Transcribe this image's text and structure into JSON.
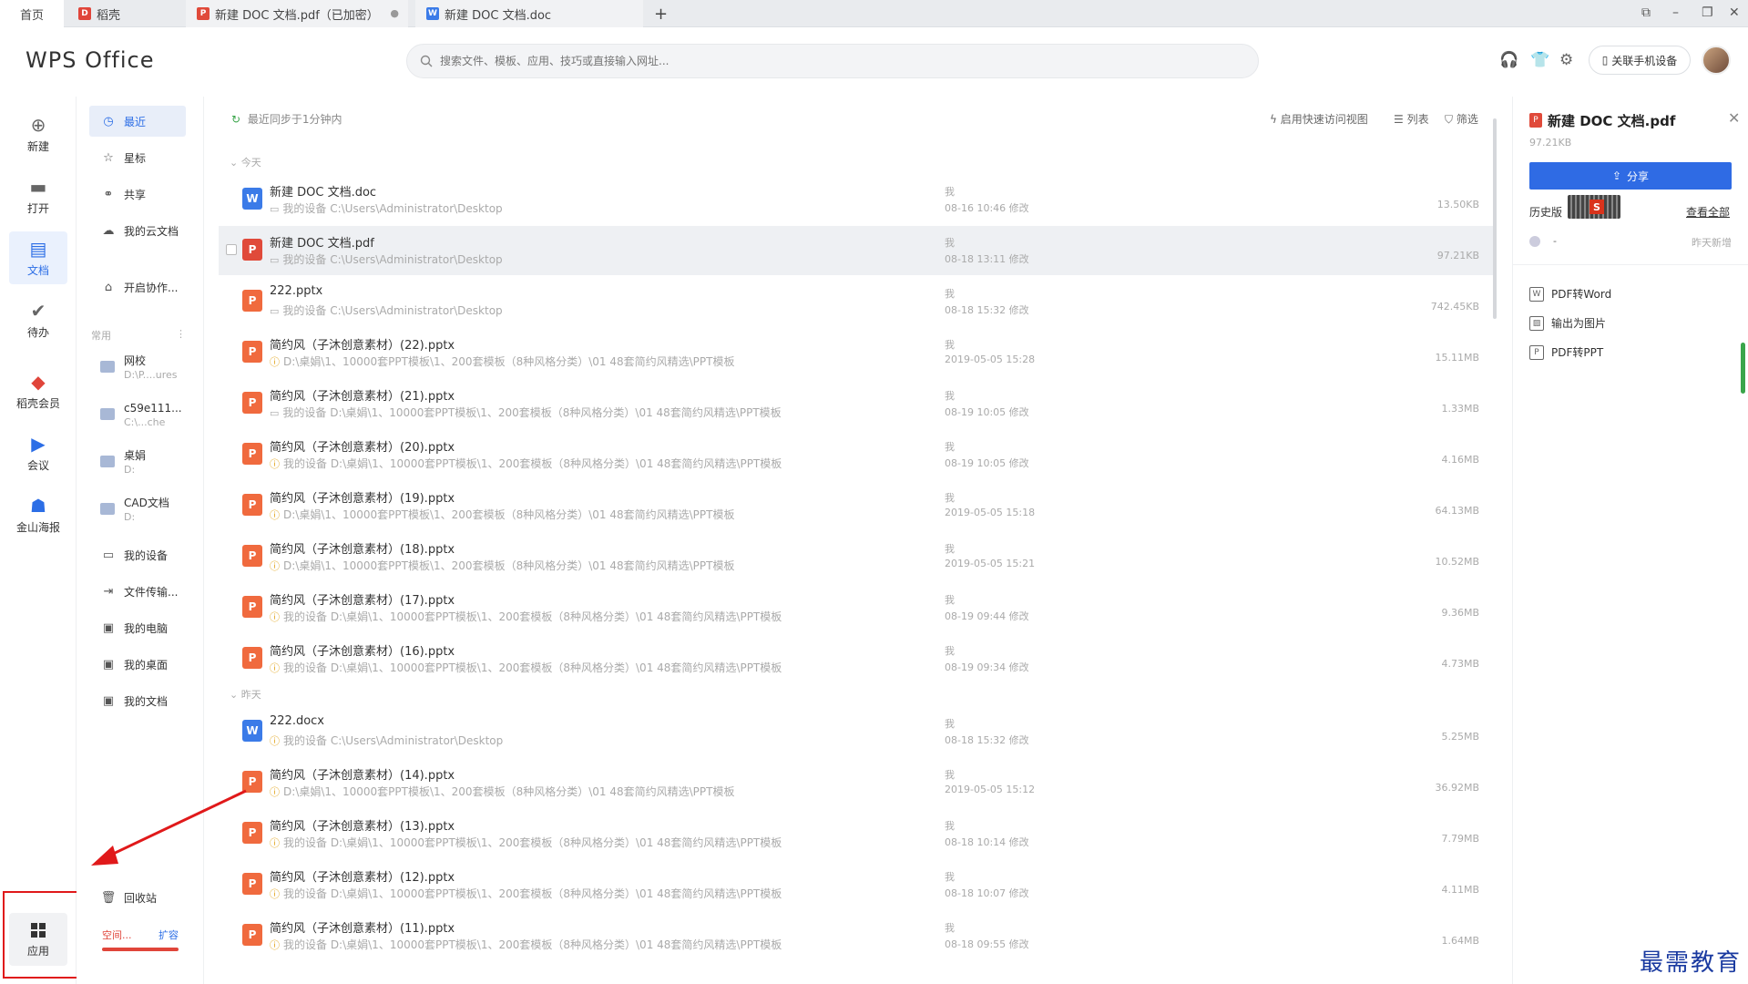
{
  "tabs": [
    {
      "label": "首页"
    },
    {
      "label": "稻壳"
    },
    {
      "label": "新建 DOC 文档.pdf（已加密）"
    },
    {
      "label": "新建 DOC 文档.doc"
    }
  ],
  "tab_add": "+",
  "window_buttons": {
    "minimize": "–",
    "restore": "❐",
    "close": "✕",
    "layout": "⧉"
  },
  "header": {
    "logo": "WPS Office",
    "search_placeholder": "搜索文件、模板、应用、技巧或直接输入网址...",
    "link_phone": "关联手机设备"
  },
  "leftnav": [
    {
      "label": "新建",
      "icon": "plus-circle-icon"
    },
    {
      "label": "打开",
      "icon": "folder-icon"
    },
    {
      "label": "文档",
      "icon": "document-icon"
    },
    {
      "label": "待办",
      "icon": "check-icon"
    },
    {
      "label": "稻壳会员",
      "icon": "docer-icon"
    },
    {
      "label": "会议",
      "icon": "meeting-icon"
    },
    {
      "label": "金山海报",
      "icon": "poster-icon"
    },
    {
      "label": "应用",
      "icon": "apps-grid-icon"
    }
  ],
  "secnav": {
    "top": [
      {
        "label": "最近"
      },
      {
        "label": "星标"
      },
      {
        "label": "共享"
      },
      {
        "label": "我的云文档"
      },
      {
        "label": "开启协作..."
      }
    ],
    "group_label": "常用",
    "group_more": "⋮",
    "folders": [
      {
        "name": "网校",
        "path": "D:\\P....ures"
      },
      {
        "name": "c59e111...",
        "path": "C:\\...che"
      },
      {
        "name": "桌娟",
        "path": "D:"
      },
      {
        "name": "CAD文档",
        "path": "D:"
      }
    ],
    "places": [
      {
        "label": "我的设备"
      },
      {
        "label": "文件传输..."
      },
      {
        "label": "我的电脑"
      },
      {
        "label": "我的桌面"
      },
      {
        "label": "我的文档"
      }
    ],
    "recycle": "回收站",
    "space": "空间...",
    "expand": "扩容"
  },
  "main": {
    "sync": "最近同步于1分钟内",
    "quick_view": "启用快速访问视图",
    "list_view": "列表",
    "filter": "筛选",
    "group_today": "今天",
    "group_yesterday": "昨天",
    "files_today": [
      {
        "type": "W",
        "name": "新建 DOC 文档.doc",
        "path": "我的设备 C:\\Users\\Administrator\\Desktop",
        "owner": "我",
        "time": "08-16 10:46 修改",
        "size": "13.50KB",
        "warn": false
      },
      {
        "type": "P",
        "name": "新建 DOC 文档.pdf",
        "path": "我的设备 C:\\Users\\Administrator\\Desktop",
        "owner": "我",
        "time": "08-18 13:11 修改",
        "size": "97.21KB",
        "warn": false
      },
      {
        "type": "P",
        "name": "222.pptx",
        "path": "我的设备 C:\\Users\\Administrator\\Desktop",
        "owner": "我",
        "time": "08-18 15:32 修改",
        "size": "742.45KB",
        "warn": false
      },
      {
        "type": "P",
        "name": "简约风（子沐创意素材）(22).pptx",
        "path": "D:\\桌娟\\1、10000套PPT模板\\1、200套模板（8种风格分类）\\01 48套简约风精选\\PPT模板",
        "owner": "我",
        "time": "2019-05-05 15:28",
        "size": "15.11MB",
        "warn": true
      },
      {
        "type": "P",
        "name": "简约风（子沐创意素材）(21).pptx",
        "path": "我的设备 D:\\桌娟\\1、10000套PPT模板\\1、200套模板（8种风格分类）\\01 48套简约风精选\\PPT模板",
        "owner": "我",
        "time": "08-19 10:05 修改",
        "size": "1.33MB",
        "warn": false
      },
      {
        "type": "P",
        "name": "简约风（子沐创意素材）(20).pptx",
        "path": "我的设备 D:\\桌娟\\1、10000套PPT模板\\1、200套模板（8种风格分类）\\01 48套简约风精选\\PPT模板",
        "owner": "我",
        "time": "08-19 10:05 修改",
        "size": "4.16MB",
        "warn": true
      },
      {
        "type": "P",
        "name": "简约风（子沐创意素材）(19).pptx",
        "path": "D:\\桌娟\\1、10000套PPT模板\\1、200套模板（8种风格分类）\\01 48套简约风精选\\PPT模板",
        "owner": "我",
        "time": "2019-05-05 15:18",
        "size": "64.13MB",
        "warn": true
      },
      {
        "type": "P",
        "name": "简约风（子沐创意素材）(18).pptx",
        "path": "D:\\桌娟\\1、10000套PPT模板\\1、200套模板（8种风格分类）\\01 48套简约风精选\\PPT模板",
        "owner": "我",
        "time": "2019-05-05 15:21",
        "size": "10.52MB",
        "warn": true
      },
      {
        "type": "P",
        "name": "简约风（子沐创意素材）(17).pptx",
        "path": "我的设备 D:\\桌娟\\1、10000套PPT模板\\1、200套模板（8种风格分类）\\01 48套简约风精选\\PPT模板",
        "owner": "我",
        "time": "08-19 09:44 修改",
        "size": "9.36MB",
        "warn": true
      },
      {
        "type": "P",
        "name": "简约风（子沐创意素材）(16).pptx",
        "path": "我的设备 D:\\桌娟\\1、10000套PPT模板\\1、200套模板（8种风格分类）\\01 48套简约风精选\\PPT模板",
        "owner": "我",
        "time": "08-19 09:34 修改",
        "size": "4.73MB",
        "warn": true
      }
    ],
    "files_yesterday": [
      {
        "type": "W",
        "name": "222.docx",
        "path": "我的设备 C:\\Users\\Administrator\\Desktop",
        "owner": "我",
        "time": "08-18 15:32 修改",
        "size": "5.25MB",
        "warn": true
      },
      {
        "type": "P",
        "name": "简约风（子沐创意素材）(14).pptx",
        "path": "D:\\桌娟\\1、10000套PPT模板\\1、200套模板（8种风格分类）\\01 48套简约风精选\\PPT模板",
        "owner": "我",
        "time": "2019-05-05 15:12",
        "size": "36.92MB",
        "warn": true
      },
      {
        "type": "P",
        "name": "简约风（子沐创意素材）(13).pptx",
        "path": "我的设备 D:\\桌娟\\1、10000套PPT模板\\1、200套模板（8种风格分类）\\01 48套简约风精选\\PPT模板",
        "owner": "我",
        "time": "08-18 10:14 修改",
        "size": "7.79MB",
        "warn": true
      },
      {
        "type": "P",
        "name": "简约风（子沐创意素材）(12).pptx",
        "path": "我的设备 D:\\桌娟\\1、10000套PPT模板\\1、200套模板（8种风格分类）\\01 48套简约风精选\\PPT模板",
        "owner": "我",
        "time": "08-18 10:07 修改",
        "size": "4.11MB",
        "warn": true
      },
      {
        "type": "P",
        "name": "简约风（子沐创意素材）(11).pptx",
        "path": "我的设备 D:\\桌娟\\1、10000套PPT模板\\1、200套模板（8种风格分类）\\01 48套简约风精选\\PPT模板",
        "owner": "我",
        "time": "08-18 09:55 修改",
        "size": "1.64MB",
        "warn": true
      }
    ]
  },
  "rpanel": {
    "title": "新建 DOC 文档.pdf",
    "size": "97.21KB",
    "share": "分享",
    "history": "历史版",
    "view_all": "查看全部",
    "version_user": "-",
    "version_time": "昨天新增",
    "actions": [
      "PDF转Word",
      "输出为图片",
      "PDF转PPT"
    ]
  },
  "watermark": "最需教育",
  "colors": {
    "accent": "#2f6be4",
    "pdf": "#e04a3a",
    "ppt": "#f06a3e",
    "word": "#3b7be8",
    "highlight": "#e0191a"
  }
}
